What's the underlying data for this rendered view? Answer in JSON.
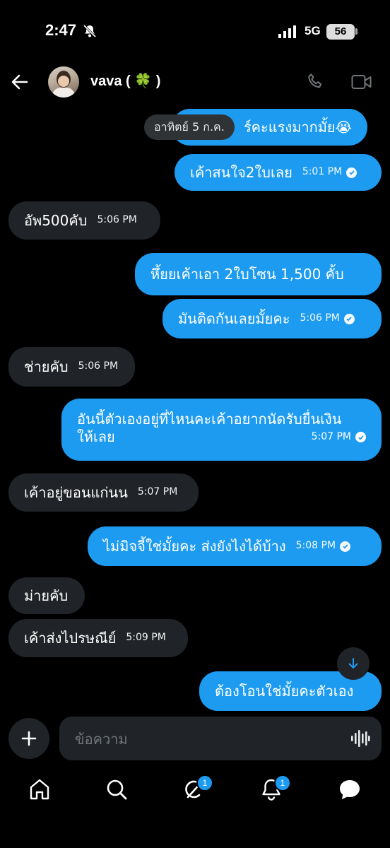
{
  "status_bar": {
    "time": "2:47",
    "network": "5G",
    "battery": "56"
  },
  "header": {
    "contact_name": "vava ( 🍀 )"
  },
  "date_chip": "อาทิตย์ 5 ก.ค.",
  "messages": [
    {
      "side": "out",
      "text": "ร์คะแรงมากมั้ย😭",
      "time": "",
      "read": false
    },
    {
      "side": "out",
      "text": "เค้าสนใจ2ใบเลย",
      "time": "5:01 PM",
      "read": true
    },
    {
      "side": "in",
      "text": "อัพ500คับ",
      "time": "5:06 PM"
    },
    {
      "side": "out",
      "text": "หึ้ยยเค้าเอา 2ใบโซน 1,500 คั้บ",
      "time": "",
      "read": false
    },
    {
      "side": "out",
      "text": "มันติดกันเลยมั้ยคะ",
      "time": "5:06 PM",
      "read": true
    },
    {
      "side": "in",
      "text": "ช่ายคับ",
      "time": "5:06 PM"
    },
    {
      "side": "out",
      "text_line1": "อันนี้ตัวเองอยู่ที่ไหนคะเค้าอยากนัดรับยื่นเงิน",
      "text_line2": "ให้เลย",
      "time": "5:07 PM",
      "read": true
    },
    {
      "side": "in",
      "text": "เค้าอยู่ขอนแก่นน",
      "time": "5:07 PM"
    },
    {
      "side": "out",
      "text": "ไม่มิจจี้ใช่มั้ยคะ ส่งยังไงได้บ้าง",
      "time": "5:08 PM",
      "read": true
    },
    {
      "side": "in",
      "text": "ม่ายคับ",
      "time": ""
    },
    {
      "side": "in",
      "text": "เค้าส่งไปรษณีย์",
      "time": "5:09 PM"
    },
    {
      "side": "out",
      "text": "ต้องโอนใช่มั้ยคะตัวเอง",
      "time": "",
      "read": false
    }
  ],
  "composer": {
    "placeholder": "ข้อความ"
  },
  "nav": {
    "grok_badge": "1",
    "notifications_badge": "1"
  },
  "colors": {
    "accent": "#1d9bf0",
    "incoming_bubble": "#202327",
    "background": "#000000"
  }
}
